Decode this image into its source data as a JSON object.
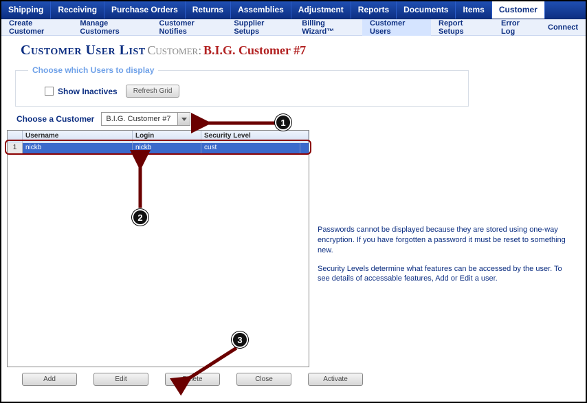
{
  "nav": {
    "top": [
      "Shipping",
      "Receiving",
      "Purchase Orders",
      "Returns",
      "Assemblies",
      "Adjustment",
      "Reports",
      "Documents",
      "Items",
      "Customer"
    ],
    "top_active": "Customer",
    "sub": [
      "Create Customer",
      "Manage Customers",
      "Customer Notifies",
      "Supplier Setups",
      "Billing Wizard™",
      "Customer Users",
      "Report Setups",
      "Error Log",
      "Connect"
    ],
    "sub_active": "Customer Users"
  },
  "title": {
    "main": "Customer User List",
    "label": "Customer:",
    "customer_name": "B.I.G. Customer #7"
  },
  "filter": {
    "legend": "Choose which Users to display",
    "show_inactives_label": "Show Inactives",
    "refresh_label": "Refresh Grid"
  },
  "picker": {
    "label": "Choose a Customer",
    "value": "B.I.G. Customer #7"
  },
  "grid": {
    "columns": [
      "Username",
      "Login",
      "Security Level"
    ],
    "rows": [
      {
        "n": "1",
        "username": "nickb",
        "login": "nickb",
        "security": "cust"
      }
    ]
  },
  "info": {
    "p1": "Passwords cannot be displayed because they are stored using one-way encryption. If you have forgotten a password it must be reset to something new.",
    "p2": "Security Levels determine what features can be accessed by the user. To see details of accessable features, Add or Edit a user."
  },
  "buttons": {
    "add": "Add",
    "edit": "Edit",
    "delete": "Delete",
    "close": "Close",
    "activate": "Activate"
  },
  "annotations": {
    "c1": "1",
    "c2": "2",
    "c3": "3"
  }
}
